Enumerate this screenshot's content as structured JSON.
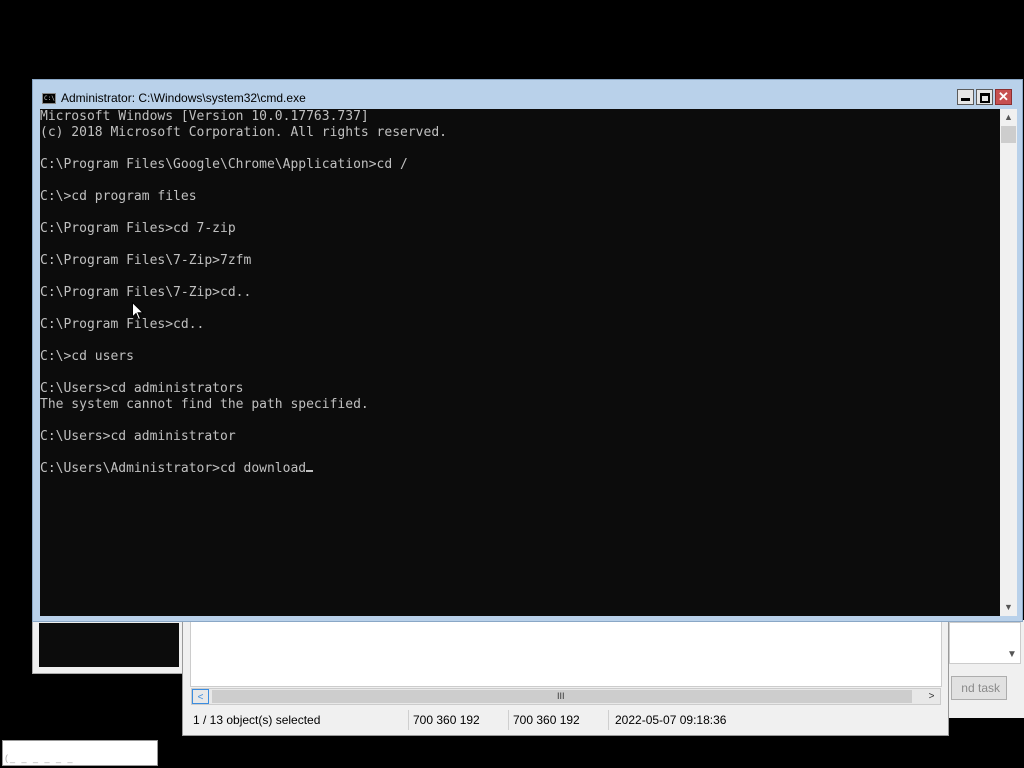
{
  "cmd_window": {
    "title": "Administrator: C:\\Windows\\system32\\cmd.exe",
    "icon_text": "C:\\",
    "close_glyph": "✕",
    "lines": [
      "Microsoft Windows [Version 10.0.17763.737]",
      "(c) 2018 Microsoft Corporation. All rights reserved.",
      "",
      "C:\\Program Files\\Google\\Chrome\\Application>cd /",
      "",
      "C:\\>cd program files",
      "",
      "C:\\Program Files>cd 7-zip",
      "",
      "C:\\Program Files\\7-Zip>7zfm",
      "",
      "C:\\Program Files\\7-Zip>cd..",
      "",
      "C:\\Program Files>cd..",
      "",
      "C:\\>cd users",
      "",
      "C:\\Users>cd administrators",
      "The system cannot find the path specified.",
      "",
      "C:\\Users>cd administrator",
      ""
    ],
    "current_prompt": "C:\\Users\\Administrator>",
    "current_input": "cd download",
    "scroll_up_glyph": "▲",
    "scroll_down_glyph": "▼"
  },
  "zip_window": {
    "status": {
      "selected": "1 / 13 object(s) selected",
      "size1": "700 360 192",
      "size2": "700 360 192",
      "modified": "2022-05-07 09:18:36"
    },
    "scroll_left_glyph": "<",
    "scroll_right_glyph": ">",
    "grip_glyph": "III"
  },
  "task_manager": {
    "end_task_label": "nd task",
    "scroll_down_glyph": "▼"
  }
}
